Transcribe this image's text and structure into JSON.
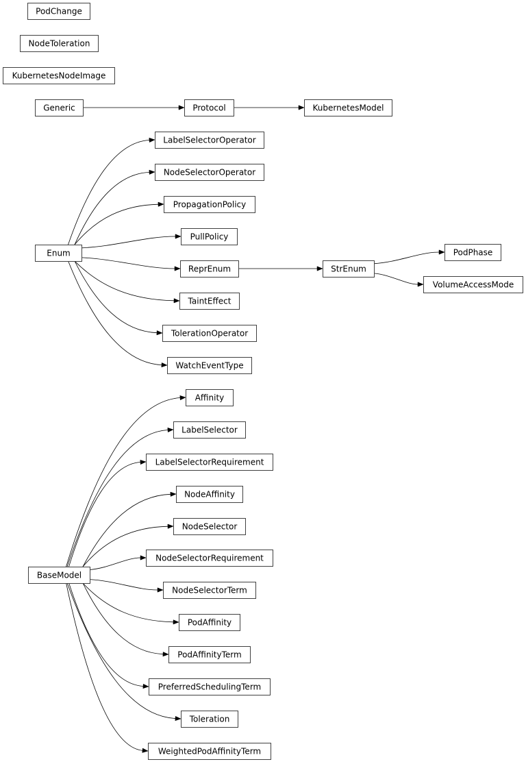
{
  "diagram": {
    "type": "class-inheritance-graph",
    "nodes": [
      {
        "id": "PodChange",
        "label": "PodChange"
      },
      {
        "id": "NodeToleration",
        "label": "NodeToleration"
      },
      {
        "id": "KubernetesNodeImage",
        "label": "KubernetesNodeImage"
      },
      {
        "id": "Generic",
        "label": "Generic"
      },
      {
        "id": "Protocol",
        "label": "Protocol"
      },
      {
        "id": "KubernetesModel",
        "label": "KubernetesModel"
      },
      {
        "id": "Enum",
        "label": "Enum"
      },
      {
        "id": "LabelSelectorOperator",
        "label": "LabelSelectorOperator"
      },
      {
        "id": "NodeSelectorOperator",
        "label": "NodeSelectorOperator"
      },
      {
        "id": "PropagationPolicy",
        "label": "PropagationPolicy"
      },
      {
        "id": "PullPolicy",
        "label": "PullPolicy"
      },
      {
        "id": "ReprEnum",
        "label": "ReprEnum"
      },
      {
        "id": "TaintEffect",
        "label": "TaintEffect"
      },
      {
        "id": "TolerationOperator",
        "label": "TolerationOperator"
      },
      {
        "id": "WatchEventType",
        "label": "WatchEventType"
      },
      {
        "id": "StrEnum",
        "label": "StrEnum"
      },
      {
        "id": "PodPhase",
        "label": "PodPhase"
      },
      {
        "id": "VolumeAccessMode",
        "label": "VolumeAccessMode"
      },
      {
        "id": "BaseModel",
        "label": "BaseModel"
      },
      {
        "id": "Affinity",
        "label": "Affinity"
      },
      {
        "id": "LabelSelector",
        "label": "LabelSelector"
      },
      {
        "id": "LabelSelectorRequirement",
        "label": "LabelSelectorRequirement"
      },
      {
        "id": "NodeAffinity",
        "label": "NodeAffinity"
      },
      {
        "id": "NodeSelector",
        "label": "NodeSelector"
      },
      {
        "id": "NodeSelectorRequirement",
        "label": "NodeSelectorRequirement"
      },
      {
        "id": "NodeSelectorTerm",
        "label": "NodeSelectorTerm"
      },
      {
        "id": "PodAffinity",
        "label": "PodAffinity"
      },
      {
        "id": "PodAffinityTerm",
        "label": "PodAffinityTerm"
      },
      {
        "id": "PreferredSchedulingTerm",
        "label": "PreferredSchedulingTerm"
      },
      {
        "id": "Toleration",
        "label": "Toleration"
      },
      {
        "id": "WeightedPodAffinityTerm",
        "label": "WeightedPodAffinityTerm"
      }
    ],
    "edges": [
      {
        "from": "Generic",
        "to": "Protocol"
      },
      {
        "from": "Protocol",
        "to": "KubernetesModel"
      },
      {
        "from": "Enum",
        "to": "LabelSelectorOperator"
      },
      {
        "from": "Enum",
        "to": "NodeSelectorOperator"
      },
      {
        "from": "Enum",
        "to": "PropagationPolicy"
      },
      {
        "from": "Enum",
        "to": "PullPolicy"
      },
      {
        "from": "Enum",
        "to": "ReprEnum"
      },
      {
        "from": "Enum",
        "to": "TaintEffect"
      },
      {
        "from": "Enum",
        "to": "TolerationOperator"
      },
      {
        "from": "Enum",
        "to": "WatchEventType"
      },
      {
        "from": "ReprEnum",
        "to": "StrEnum"
      },
      {
        "from": "StrEnum",
        "to": "PodPhase"
      },
      {
        "from": "StrEnum",
        "to": "VolumeAccessMode"
      },
      {
        "from": "BaseModel",
        "to": "Affinity"
      },
      {
        "from": "BaseModel",
        "to": "LabelSelector"
      },
      {
        "from": "BaseModel",
        "to": "LabelSelectorRequirement"
      },
      {
        "from": "BaseModel",
        "to": "NodeAffinity"
      },
      {
        "from": "BaseModel",
        "to": "NodeSelector"
      },
      {
        "from": "BaseModel",
        "to": "NodeSelectorRequirement"
      },
      {
        "from": "BaseModel",
        "to": "NodeSelectorTerm"
      },
      {
        "from": "BaseModel",
        "to": "PodAffinity"
      },
      {
        "from": "BaseModel",
        "to": "PodAffinityTerm"
      },
      {
        "from": "BaseModel",
        "to": "PreferredSchedulingTerm"
      },
      {
        "from": "BaseModel",
        "to": "Toleration"
      },
      {
        "from": "BaseModel",
        "to": "WeightedPodAffinityTerm"
      }
    ]
  }
}
